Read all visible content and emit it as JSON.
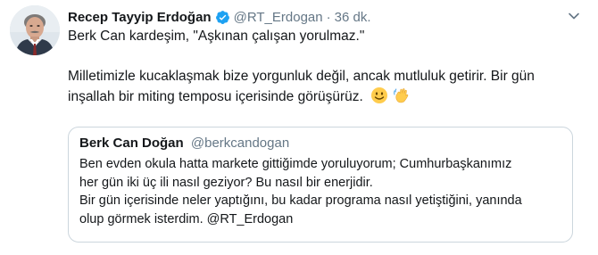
{
  "tweet": {
    "author": {
      "name": "Recep Tayyip Erdoğan",
      "handle": "@RT_Erdogan",
      "verified": true
    },
    "separator": "·",
    "time": "36 dk.",
    "lines": [
      "Berk Can kardeşim, \"Aşkınan çalışan yorulmaz.\"",
      "Milletimizle kucaklaşmak bize yorgunluk değil, ancak mutluluk getirir. Bir gün",
      "inşallah bir miting temposu içerisinde görüşürüz."
    ],
    "emojis": [
      "smiling-face-icon",
      "waving-hand-icon"
    ]
  },
  "quote": {
    "name": "Berk Can Doğan",
    "handle": "@berkcandogan",
    "lines": [
      "Ben evden okula hatta markete gittiğimde yoruluyorum; Cumhurbaşkanımız",
      "her gün iki üç ili nasıl geziyor? Bu nasıl bir enerjidir.",
      "Bir gün içerisinde neler yaptığını, bu kadar programa nasıl yetiştiğini, yanında",
      "olup görmek isterdim. @RT_Erdogan"
    ]
  },
  "colors": {
    "text": "#14171a",
    "secondary": "#657786",
    "verified": "#1da1f2",
    "border": "#ccd6dd",
    "emoji_yellow": "#ffcc4d"
  }
}
